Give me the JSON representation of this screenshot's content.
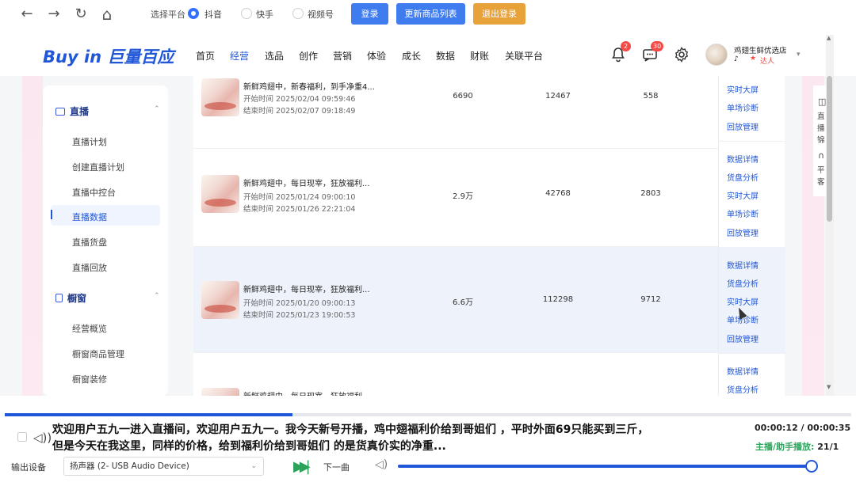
{
  "topbar": {
    "nav": {
      "back": "←",
      "forward": "→",
      "refresh": "↻",
      "home": "⌂"
    },
    "platform_label": "选择平台",
    "platforms": [
      {
        "label": "抖音",
        "selected": true
      },
      {
        "label": "快手",
        "selected": false
      },
      {
        "label": "视频号",
        "selected": false
      }
    ],
    "buttons": {
      "login": "登录",
      "update_list": "更新商品列表",
      "logout": "退出登录"
    },
    "colors": {
      "primary": "#3f7cf0",
      "warning": "#e8a23a"
    }
  },
  "header": {
    "logo": "Buy in 巨量百应",
    "menu": [
      {
        "label": "首页",
        "active": false
      },
      {
        "label": "经营",
        "active": true
      },
      {
        "label": "选品",
        "active": false
      },
      {
        "label": "创作",
        "active": false
      },
      {
        "label": "营销",
        "active": false
      },
      {
        "label": "体验",
        "active": false
      },
      {
        "label": "成长",
        "active": false
      },
      {
        "label": "数据",
        "active": false
      },
      {
        "label": "财账",
        "active": false
      },
      {
        "label": "关联平台",
        "active": false
      }
    ],
    "bell_badge": "2",
    "message_badge": "30",
    "shop_name": "鸡翅生鲜优选店",
    "role": "达人"
  },
  "sidebar": {
    "groups": [
      {
        "label": "直播",
        "items": [
          {
            "label": "直播计划",
            "active": false
          },
          {
            "label": "创建直播计划",
            "active": false
          },
          {
            "label": "直播中控台",
            "active": false
          },
          {
            "label": "直播数据",
            "active": true
          },
          {
            "label": "直播货盘",
            "active": false
          },
          {
            "label": "直播回放",
            "active": false
          }
        ]
      },
      {
        "label": "橱窗",
        "items": [
          {
            "label": "经营概览",
            "active": false
          },
          {
            "label": "橱窗商品管理",
            "active": false
          },
          {
            "label": "橱窗装修",
            "active": false
          }
        ]
      }
    ]
  },
  "table": {
    "rows": [
      {
        "title": "新鲜鸡翅中，新春福利，到手净重4...",
        "start": "开始时间  2025/02/04 09:59:46",
        "end": "结束时间  2025/02/07 09:18:49",
        "c1": "6690",
        "c2": "12467",
        "c3": "558"
      },
      {
        "title": "新鲜鸡翅中，每日现宰，狂放福利...",
        "start": "开始时间  2025/01/24 09:00:10",
        "end": "结束时间  2025/01/26 22:21:04",
        "c1": "2.9万",
        "c2": "42768",
        "c3": "2803"
      },
      {
        "title": "新鲜鸡翅中，每日现宰，狂放福利...",
        "start": "开始时间  2025/01/20 09:00:13",
        "end": "结束时间  2025/01/23 19:00:53",
        "c1": "6.6万",
        "c2": "112298",
        "c3": "9712"
      },
      {
        "title": "新鲜鸡翅中，每日现宰，狂放福利...",
        "start": "",
        "end": "",
        "c1": "",
        "c2": "",
        "c3": ""
      }
    ],
    "ops": [
      "数据详情",
      "货盘分析",
      "实时大屏",
      "单场诊断",
      "回放管理"
    ]
  },
  "right_float": {
    "a": "直播锦",
    "b": "平客"
  },
  "player": {
    "subtitle_1": "欢迎用户五九一进入直播间，欢迎用户五九一。我今天新号开播，鸡中翅福利价给到哥姐们 ，平时外面69只能买到三斤，",
    "subtitle_2": "但是今天在我这里，同样的价格，给到福利价给到哥姐们 的是货真价实的净重...",
    "time": "00:00:12 / 00:00:35",
    "status": "主播/助手播放:",
    "status_index": "21/1",
    "progress": 0.34,
    "output_label": "输出设备",
    "output_device": "扬声器 (2- USB Audio Device)",
    "next_label": "下一曲",
    "volume": 1.0
  }
}
